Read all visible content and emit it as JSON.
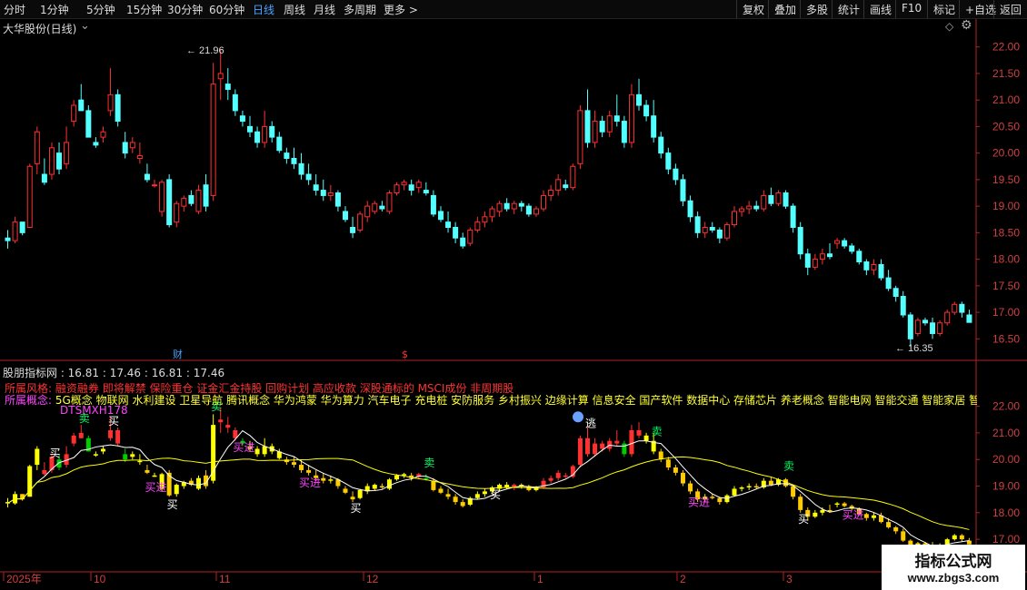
{
  "toolbar": {
    "periods": [
      "分时",
      "1分钟",
      "5分钟",
      "15分钟",
      "30分钟",
      "60分钟",
      "日线",
      "周线",
      "月线",
      "多周期",
      "更多 >"
    ],
    "active_period": "日线",
    "right_buttons": [
      "复权",
      "叠加",
      "多股",
      "统计",
      "画线",
      "F10",
      "标记",
      "+自选",
      "返回"
    ]
  },
  "main": {
    "title": "大华股份(日线)",
    "high_label": "21.96",
    "low_label": "16.35",
    "axis_ticks": [
      "22.00",
      "21.50",
      "21.00",
      "20.50",
      "20.00",
      "19.50",
      "19.00",
      "18.50",
      "18.00",
      "17.50",
      "17.00",
      "16.50"
    ],
    "markers": {
      "cai": "财",
      "dollar": "$"
    }
  },
  "indicator": {
    "title": "股朋指标网 : 16.81 : 17.46 : 16.81 : 17.46",
    "style_label": "所属风格:",
    "style_value": "融资融券 即将解禁 保险重仓 证金汇金持股 回购计划 高应收款 深股通标的 MSCI成份 非周期股",
    "concept_label": "所属概念:",
    "concept_value": "5G概念 物联网 水利建设 卫星导航 腾讯概念 华为鸿蒙 华为算力 汽车电子 充电桩 安防服务 乡村振兴 边缘计算 信息安全 国产软件 数据中心 存储芯片 养老概念 智能电网 智能交通 智能家居 智慧",
    "name": "DTSMXH178",
    "axis_ticks": [
      "22.00",
      "21.00",
      "20.00",
      "19.00",
      "18.00",
      "17.00"
    ],
    "signals": {
      "sell": "卖",
      "buy": "买",
      "buy_in": "买进",
      "escape": "逃"
    }
  },
  "date_axis": [
    "2025年",
    "10",
    "11",
    "12",
    "1",
    "2",
    "3"
  ],
  "watermark": {
    "line1": "指标公式网",
    "line2": "www.zbgs3.com"
  },
  "colors": {
    "up": "#ff3030",
    "down": "#54ffff",
    "yellow": "#ffff00",
    "green": "#00cc00",
    "magenta": "#ff44ff",
    "axis": "#b22222"
  },
  "chart_data": {
    "type": "candlestick",
    "main_ylim": [
      16.3,
      22.2
    ],
    "indicator_ylim": [
      16.8,
      22.6
    ],
    "dates_axis_labels": [
      "2025年",
      "10",
      "11",
      "12",
      "1",
      "2",
      "3"
    ],
    "candles": [
      [
        18.4,
        18.55,
        18.2,
        18.35
      ],
      [
        18.35,
        18.8,
        18.3,
        18.7
      ],
      [
        18.7,
        18.7,
        18.45,
        18.5
      ],
      [
        18.6,
        19.8,
        18.6,
        19.75
      ],
      [
        19.8,
        20.5,
        19.6,
        20.4
      ],
      [
        19.6,
        19.9,
        19.4,
        19.45
      ],
      [
        19.6,
        20.2,
        19.5,
        20.1
      ],
      [
        20.0,
        20.2,
        19.6,
        19.7
      ],
      [
        19.8,
        20.5,
        19.7,
        20.2
      ],
      [
        20.6,
        21.0,
        20.5,
        20.9
      ],
      [
        21.0,
        21.3,
        20.8,
        20.8
      ],
      [
        20.8,
        20.9,
        20.3,
        20.3
      ],
      [
        20.2,
        20.3,
        20.1,
        20.15
      ],
      [
        20.3,
        20.5,
        20.2,
        20.4
      ],
      [
        20.8,
        21.6,
        20.7,
        21.1
      ],
      [
        21.1,
        21.2,
        20.5,
        20.6
      ],
      [
        20.2,
        20.4,
        19.9,
        20.0
      ],
      [
        20.1,
        20.3,
        20.0,
        20.2
      ],
      [
        19.9,
        20.2,
        19.8,
        19.95
      ],
      [
        19.6,
        19.8,
        19.45,
        19.5
      ],
      [
        19.4,
        19.5,
        19.35,
        19.4
      ],
      [
        18.9,
        19.5,
        18.8,
        19.45
      ],
      [
        19.5,
        19.6,
        18.6,
        18.65
      ],
      [
        18.7,
        19.1,
        18.6,
        19.05
      ],
      [
        19.0,
        19.2,
        18.9,
        19.15
      ],
      [
        19.2,
        19.3,
        19.0,
        19.05
      ],
      [
        18.9,
        19.4,
        18.85,
        19.3
      ],
      [
        19.4,
        19.6,
        18.9,
        19.0
      ],
      [
        19.2,
        21.7,
        19.1,
        21.3
      ],
      [
        21.4,
        21.96,
        21.0,
        21.5
      ],
      [
        21.3,
        21.6,
        21.0,
        21.2
      ],
      [
        21.1,
        21.2,
        20.7,
        20.8
      ],
      [
        20.7,
        20.8,
        20.5,
        20.6
      ],
      [
        20.5,
        20.7,
        20.3,
        20.4
      ],
      [
        20.4,
        20.5,
        20.1,
        20.2
      ],
      [
        20.2,
        20.8,
        20.1,
        20.5
      ],
      [
        20.5,
        20.6,
        20.2,
        20.3
      ],
      [
        20.3,
        20.4,
        20.0,
        20.05
      ],
      [
        20.0,
        20.1,
        19.8,
        19.9
      ],
      [
        19.9,
        20.1,
        19.7,
        19.8
      ],
      [
        19.8,
        20.0,
        19.5,
        19.6
      ],
      [
        19.6,
        19.8,
        19.4,
        19.5
      ],
      [
        19.4,
        19.6,
        19.2,
        19.3
      ],
      [
        19.3,
        19.5,
        19.1,
        19.2
      ],
      [
        19.2,
        19.4,
        19.1,
        19.25
      ],
      [
        19.25,
        19.3,
        18.9,
        19.0
      ],
      [
        18.9,
        19.0,
        18.7,
        18.75
      ],
      [
        18.6,
        18.8,
        18.4,
        18.5
      ],
      [
        18.55,
        18.9,
        18.5,
        18.85
      ],
      [
        18.8,
        19.1,
        18.7,
        19.0
      ],
      [
        18.9,
        19.1,
        18.85,
        19.05
      ],
      [
        19.0,
        19.1,
        18.9,
        18.95
      ],
      [
        18.9,
        19.3,
        18.85,
        19.25
      ],
      [
        19.25,
        19.45,
        19.2,
        19.4
      ],
      [
        19.4,
        19.5,
        19.3,
        19.45
      ],
      [
        19.4,
        19.5,
        19.2,
        19.3
      ],
      [
        19.35,
        19.5,
        19.25,
        19.45
      ],
      [
        19.3,
        19.45,
        19.2,
        19.25
      ],
      [
        19.2,
        19.3,
        18.8,
        18.85
      ],
      [
        18.9,
        19.0,
        18.7,
        18.75
      ],
      [
        18.7,
        18.9,
        18.5,
        18.6
      ],
      [
        18.6,
        18.7,
        18.3,
        18.4
      ],
      [
        18.4,
        18.5,
        18.2,
        18.25
      ],
      [
        18.3,
        18.6,
        18.25,
        18.55
      ],
      [
        18.55,
        18.8,
        18.5,
        18.7
      ],
      [
        18.7,
        18.9,
        18.6,
        18.8
      ],
      [
        18.8,
        19.0,
        18.7,
        18.95
      ],
      [
        18.9,
        19.1,
        18.8,
        19.05
      ],
      [
        19.05,
        19.15,
        18.9,
        18.95
      ],
      [
        18.95,
        19.1,
        18.85,
        19.05
      ],
      [
        19.05,
        19.1,
        18.9,
        19.0
      ],
      [
        19.0,
        19.05,
        18.8,
        18.85
      ],
      [
        18.85,
        19.0,
        18.8,
        18.95
      ],
      [
        18.95,
        19.3,
        18.9,
        19.2
      ],
      [
        19.2,
        19.4,
        19.1,
        19.3
      ],
      [
        19.3,
        19.6,
        19.2,
        19.5
      ],
      [
        19.4,
        19.5,
        19.3,
        19.35
      ],
      [
        19.35,
        19.8,
        19.3,
        19.75
      ],
      [
        19.8,
        20.9,
        19.7,
        20.8
      ],
      [
        20.8,
        21.2,
        20.1,
        20.2
      ],
      [
        20.2,
        20.8,
        20.1,
        20.6
      ],
      [
        20.6,
        20.7,
        20.3,
        20.4
      ],
      [
        20.4,
        20.8,
        20.3,
        20.7
      ],
      [
        20.7,
        21.1,
        20.5,
        20.6
      ],
      [
        20.6,
        20.7,
        20.1,
        20.2
      ],
      [
        20.2,
        21.3,
        20.1,
        21.1
      ],
      [
        21.1,
        21.4,
        20.8,
        20.9
      ],
      [
        20.9,
        21.0,
        20.6,
        20.7
      ],
      [
        20.7,
        21.0,
        20.2,
        20.3
      ],
      [
        20.3,
        20.4,
        19.9,
        20.0
      ],
      [
        20.0,
        20.1,
        19.6,
        19.7
      ],
      [
        19.7,
        19.8,
        19.4,
        19.5
      ],
      [
        19.5,
        19.6,
        19.0,
        19.1
      ],
      [
        19.1,
        19.2,
        18.7,
        18.8
      ],
      [
        18.8,
        18.9,
        18.4,
        18.5
      ],
      [
        18.5,
        18.7,
        18.4,
        18.6
      ],
      [
        18.6,
        18.7,
        18.5,
        18.55
      ],
      [
        18.55,
        18.6,
        18.3,
        18.4
      ],
      [
        18.4,
        18.7,
        18.35,
        18.65
      ],
      [
        18.65,
        19.0,
        18.6,
        18.9
      ],
      [
        18.9,
        19.0,
        18.8,
        18.95
      ],
      [
        18.95,
        19.1,
        18.85,
        19.0
      ],
      [
        19.0,
        19.1,
        18.9,
        18.95
      ],
      [
        18.95,
        19.3,
        18.9,
        19.2
      ],
      [
        19.2,
        19.35,
        19.0,
        19.05
      ],
      [
        19.05,
        19.3,
        19.0,
        19.25
      ],
      [
        19.25,
        19.3,
        18.95,
        19.0
      ],
      [
        19.0,
        19.05,
        18.5,
        18.6
      ],
      [
        18.6,
        18.7,
        18.0,
        18.1
      ],
      [
        18.1,
        18.2,
        17.7,
        17.85
      ],
      [
        17.85,
        18.1,
        17.8,
        18.0
      ],
      [
        18.0,
        18.2,
        17.9,
        18.1
      ],
      [
        18.1,
        18.3,
        18.0,
        18.05
      ],
      [
        18.3,
        18.4,
        18.2,
        18.35
      ],
      [
        18.35,
        18.4,
        18.2,
        18.25
      ],
      [
        18.25,
        18.3,
        18.1,
        18.15
      ],
      [
        18.15,
        18.2,
        17.9,
        17.95
      ],
      [
        17.95,
        18.0,
        17.7,
        17.8
      ],
      [
        17.8,
        18.0,
        17.7,
        17.9
      ],
      [
        17.9,
        18.0,
        17.6,
        17.65
      ],
      [
        17.65,
        17.8,
        17.4,
        17.45
      ],
      [
        17.45,
        17.5,
        17.2,
        17.3
      ],
      [
        17.3,
        17.4,
        16.9,
        16.95
      ],
      [
        16.95,
        17.0,
        16.35,
        16.5
      ],
      [
        16.6,
        16.9,
        16.55,
        16.85
      ],
      [
        16.85,
        16.9,
        16.75,
        16.8
      ],
      [
        16.8,
        16.9,
        16.5,
        16.6
      ],
      [
        16.6,
        16.85,
        16.55,
        16.8
      ],
      [
        16.8,
        17.05,
        16.75,
        17.0
      ],
      [
        17.0,
        17.2,
        16.95,
        17.15
      ],
      [
        17.15,
        17.2,
        16.9,
        17.0
      ],
      [
        16.95,
        17.05,
        16.81,
        16.81
      ]
    ]
  }
}
